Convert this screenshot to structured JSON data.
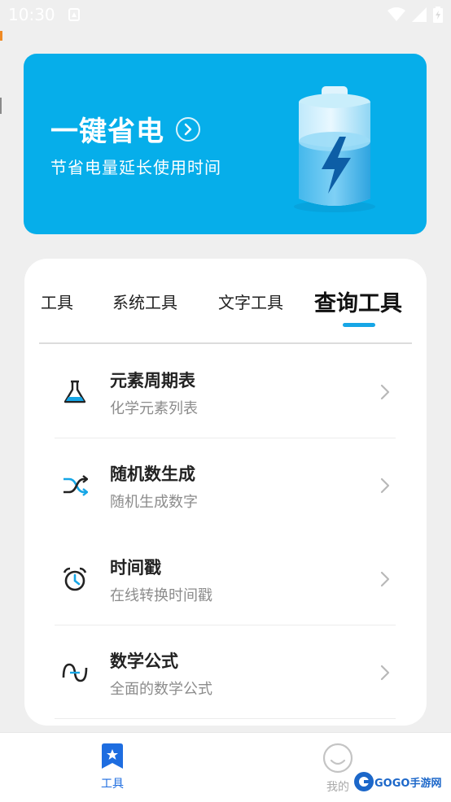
{
  "status_bar": {
    "time": "10:30"
  },
  "banner": {
    "title": "一键省电",
    "subtitle": "节省电量延长使用时间",
    "bg_color": "#06aeea"
  },
  "tabs": {
    "items": [
      {
        "label": "工具",
        "active": false
      },
      {
        "label": "系统工具",
        "active": false
      },
      {
        "label": "文字工具",
        "active": false
      },
      {
        "label": "查询工具",
        "active": true
      }
    ],
    "indicator_color": "#16a6e6"
  },
  "tools": [
    {
      "title": "元素周期表",
      "subtitle": "化学元素列表",
      "icon": "flask-icon"
    },
    {
      "title": "随机数生成",
      "subtitle": "随机生成数字",
      "icon": "shuffle-icon"
    },
    {
      "title": "时间戳",
      "subtitle": "在线转换时间戳",
      "icon": "alarm-clock-icon"
    },
    {
      "title": "数学公式",
      "subtitle": "全面的数学公式",
      "icon": "sine-wave-icon"
    }
  ],
  "bottom_nav": {
    "items": [
      {
        "label": "工具",
        "icon": "bookmark-star-icon",
        "active": true
      },
      {
        "label": "我的",
        "icon": "smile-face-icon",
        "active": false
      }
    ],
    "active_color": "#1e6de0"
  },
  "watermark": {
    "text": "GOGO手游网"
  }
}
